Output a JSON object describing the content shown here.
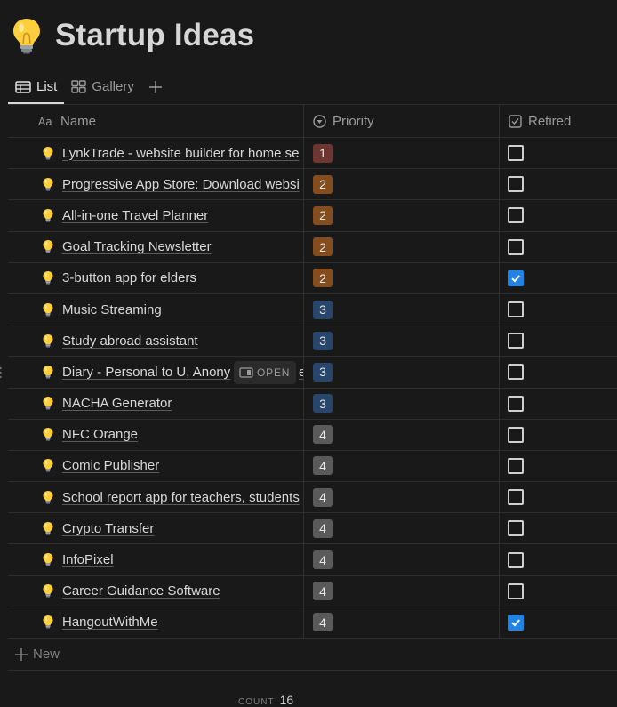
{
  "page": {
    "title": "Startup Ideas",
    "icon": "lightbulb-icon"
  },
  "tabs": [
    {
      "label": "List",
      "icon": "table-icon",
      "active": true
    },
    {
      "label": "Gallery",
      "icon": "gallery-icon",
      "active": false
    }
  ],
  "columns": {
    "name": {
      "label": "Name",
      "icon": "text-type-icon"
    },
    "priority": {
      "label": "Priority",
      "icon": "select-icon"
    },
    "retired": {
      "label": "Retired",
      "icon": "checkbox-icon"
    }
  },
  "rows": [
    {
      "name": "LynkTrade - website builder for home se",
      "priority": "1",
      "retired": false
    },
    {
      "name": "Progressive App Store: Download websi",
      "priority": "2",
      "retired": false
    },
    {
      "name": "All-in-one Travel Planner",
      "priority": "2",
      "retired": false
    },
    {
      "name": "Goal Tracking Newsletter",
      "priority": "2",
      "retired": false
    },
    {
      "name": "3-button app for elders",
      "priority": "2",
      "retired": true
    },
    {
      "name": "Music Streaming",
      "priority": "3",
      "retired": false
    },
    {
      "name": "Study abroad assistant",
      "priority": "3",
      "retired": false
    },
    {
      "name": "Diary - Personal to U, Anony",
      "name_tail": "e",
      "priority": "3",
      "retired": false,
      "hover": true
    },
    {
      "name": "NACHA Generator",
      "priority": "3",
      "retired": false
    },
    {
      "name": "NFC Orange",
      "priority": "4",
      "retired": false
    },
    {
      "name": "Comic Publisher",
      "priority": "4",
      "retired": false
    },
    {
      "name": "School report app for teachers, students",
      "priority": "4",
      "retired": false
    },
    {
      "name": "Crypto Transfer",
      "priority": "4",
      "retired": false
    },
    {
      "name": "InfoPixel",
      "priority": "4",
      "retired": false
    },
    {
      "name": "Career Guidance Software",
      "priority": "4",
      "retired": false
    },
    {
      "name": "HangoutWithMe",
      "priority": "4",
      "retired": true
    }
  ],
  "open_label": "OPEN",
  "new_label": "New",
  "footer": {
    "count_label": "COUNT",
    "count_value": "16"
  },
  "colors": {
    "background": "#191919",
    "priority_1": "#6e3630",
    "priority_2": "#854c1d",
    "priority_3": "#28456c",
    "priority_4": "#5a5a5a",
    "checkbox_checked": "#2383e2"
  }
}
